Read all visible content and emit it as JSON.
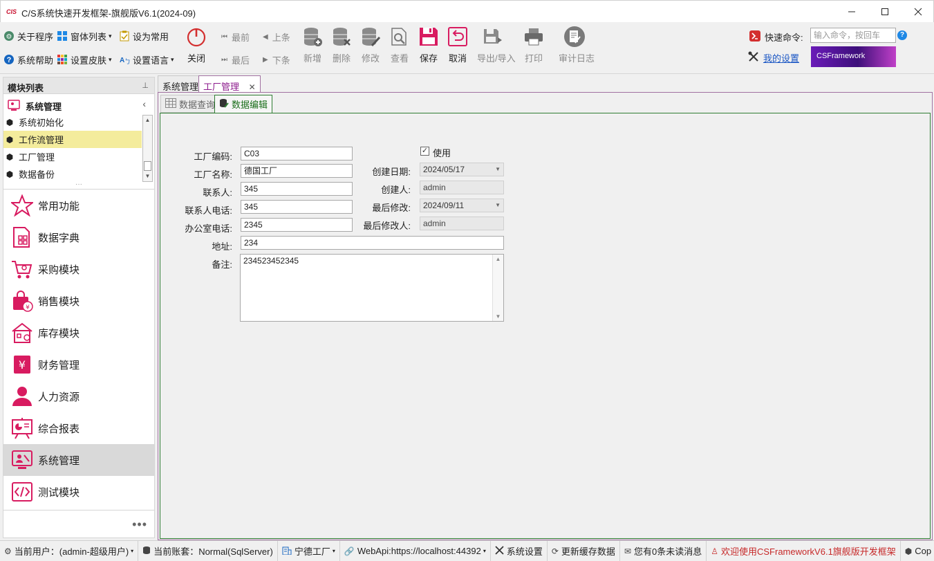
{
  "window": {
    "logo": "CIS",
    "title": "C/S系统快速开发框架-旗舰版V6.1(2024-09)",
    "controls": [
      "minimize",
      "maximize",
      "close"
    ]
  },
  "ribbon": {
    "small_left": [
      {
        "label": "关于程序",
        "icon": "about-icon"
      },
      {
        "label": "窗体列表",
        "icon": "windows-icon",
        "dropdown": true
      },
      {
        "label": "设为常用",
        "icon": "clipboard-icon"
      },
      {
        "label": "系统帮助",
        "icon": "help-icon"
      },
      {
        "label": "设置皮肤",
        "icon": "skin-icon",
        "dropdown": true
      },
      {
        "label": "设置语言",
        "icon": "language-icon",
        "dropdown": true
      }
    ],
    "close_label": "关闭",
    "nav": {
      "first": "最前",
      "prev": "上条",
      "last": "最后",
      "next": "下条"
    },
    "actions": [
      {
        "label": "新增",
        "icon": "add-db-icon",
        "enabled": false
      },
      {
        "label": "删除",
        "icon": "delete-db-icon",
        "enabled": false
      },
      {
        "label": "修改",
        "icon": "edit-db-icon",
        "enabled": false
      },
      {
        "label": "查看",
        "icon": "view-icon",
        "enabled": false
      },
      {
        "label": "保存",
        "icon": "save-icon",
        "enabled": true
      },
      {
        "label": "取消",
        "icon": "cancel-icon",
        "enabled": true
      },
      {
        "label": "导出/导入",
        "icon": "export-icon",
        "enabled": false
      },
      {
        "label": "打印",
        "icon": "print-icon",
        "enabled": false
      },
      {
        "label": "审计日志",
        "icon": "audit-icon",
        "enabled": false
      }
    ],
    "command_label": "快速命令:",
    "command_placeholder": "输入命令，按回车",
    "help_glyph": "?",
    "my_settings": "我的设置",
    "banner_text": "CSFramework"
  },
  "left_panel": {
    "header": "模块列表",
    "group_title": "系统管理",
    "sub_items": [
      "系统初始化",
      "工作流管理",
      "工厂管理",
      "数据备份"
    ],
    "active_sub_item": 1,
    "modules": [
      {
        "label": "常用功能",
        "icon": "star-icon"
      },
      {
        "label": "数据字典",
        "icon": "dictionary-icon"
      },
      {
        "label": "采购模块",
        "icon": "cart-icon"
      },
      {
        "label": "销售模块",
        "icon": "shopping-bag-icon"
      },
      {
        "label": "库存模块",
        "icon": "warehouse-icon"
      },
      {
        "label": "财务管理",
        "icon": "finance-icon"
      },
      {
        "label": "人力资源",
        "icon": "person-icon"
      },
      {
        "label": "综合报表",
        "icon": "report-icon"
      },
      {
        "label": "系统管理",
        "icon": "system-admin-icon"
      },
      {
        "label": "测试模块",
        "icon": "code-icon"
      }
    ],
    "active_module": 8,
    "more": "•••"
  },
  "doc_tabs": [
    {
      "label": "系统管理",
      "active": false
    },
    {
      "label": "工厂管理",
      "active": true,
      "closable": true
    }
  ],
  "sub_tabs": [
    {
      "label": "数据查询",
      "icon": "grid-icon",
      "active": false
    },
    {
      "label": "数据编辑",
      "icon": "database-edit-icon",
      "active": true
    }
  ],
  "form": {
    "factory_code": {
      "label": "工厂编码:",
      "value": "C03"
    },
    "factory_name": {
      "label": "工厂名称:",
      "value": "德国工厂"
    },
    "contact": {
      "label": "联系人:",
      "value": "345"
    },
    "contact_phone": {
      "label": "联系人电话:",
      "value": "345"
    },
    "office_phone": {
      "label": "办公室电话:",
      "value": "2345"
    },
    "address": {
      "label": "地址:",
      "value": "234"
    },
    "remarks": {
      "label": "备注:",
      "value": "234523452345"
    },
    "in_use": {
      "label": "使用",
      "checked": true
    },
    "created_date": {
      "label": "创建日期:",
      "value": "2024/05/17"
    },
    "created_by": {
      "label": "创建人:",
      "value": "admin"
    },
    "modified_date": {
      "label": "最后修改:",
      "value": "2024/09/11"
    },
    "modified_by": {
      "label": "最后修改人:",
      "value": "admin"
    }
  },
  "status_bar": [
    {
      "label": "当前用户：(admin-超级用户)",
      "icon": "user-gear-icon",
      "dropdown": true
    },
    {
      "label": "当前账套：Normal(SqlServer)",
      "icon": "database-icon"
    },
    {
      "label": "宁德工厂",
      "icon": "building-icon",
      "dropdown": true
    },
    {
      "label": "WebApi:https://localhost:44392",
      "icon": "link-icon",
      "dropdown": true
    },
    {
      "label": "系统设置",
      "icon": "tools-icon"
    },
    {
      "label": "更新缓存数据",
      "icon": "refresh-icon"
    },
    {
      "label": "您有0条未读消息",
      "icon": "mail-icon"
    },
    {
      "label": "欢迎使用CSFrameworkV6.1旗舰版开发框架",
      "icon": "welcome-icon",
      "color": "#c62828"
    },
    {
      "label": "Cop",
      "icon": "cube-icon"
    }
  ],
  "colors": {
    "accent": "#d81b60",
    "active_tab": "#8c1a8c",
    "edit_tab": "#2e7d32",
    "selected_row": "#f4ec9c"
  }
}
